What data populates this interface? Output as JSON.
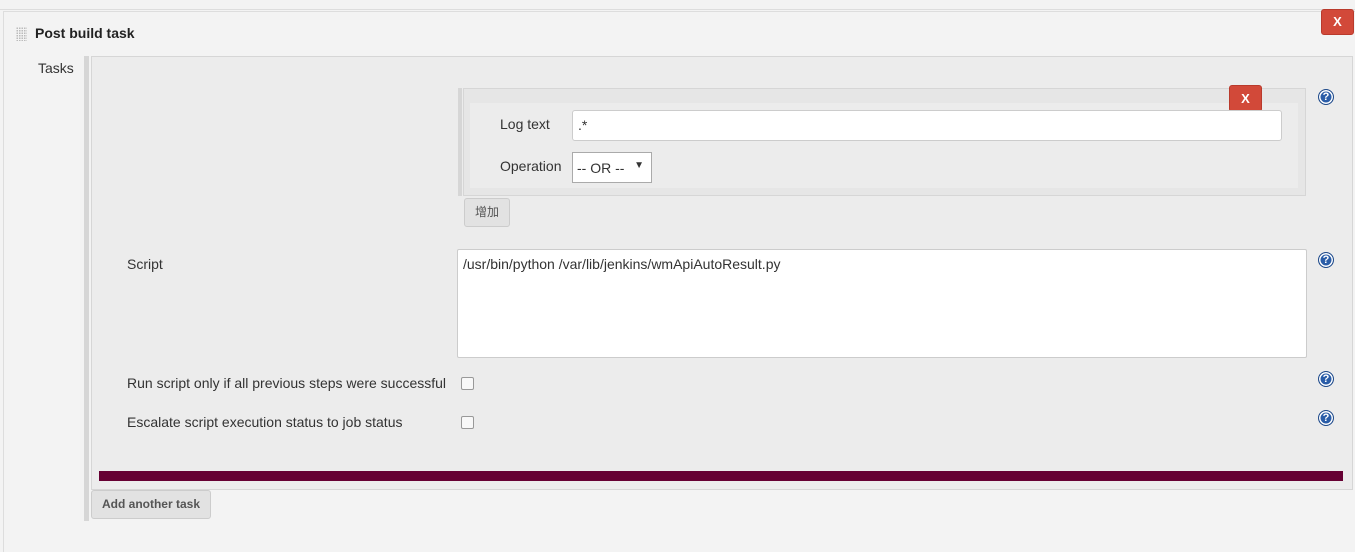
{
  "section": {
    "title": "Post build task",
    "delete_label": "X",
    "tasks_label": "Tasks"
  },
  "log_entry": {
    "delete_label": "X",
    "log_text_label": "Log text",
    "log_text_value": ".*",
    "operation_label": "Operation",
    "operation_value": "-- OR --",
    "add_label": "增加"
  },
  "script": {
    "label": "Script",
    "value": "/usr/bin/python /var/lib/jenkins/wmApiAutoResult.py"
  },
  "options": [
    {
      "label": "Run script only if all previous steps were successful",
      "checked": false
    },
    {
      "label": "Escalate script execution status to job status",
      "checked": false
    }
  ],
  "add_task_label": "Add another task",
  "help_glyph": "?",
  "colors": {
    "delete": "#d24939",
    "divider": "#660033",
    "help": "#2a5da8"
  }
}
